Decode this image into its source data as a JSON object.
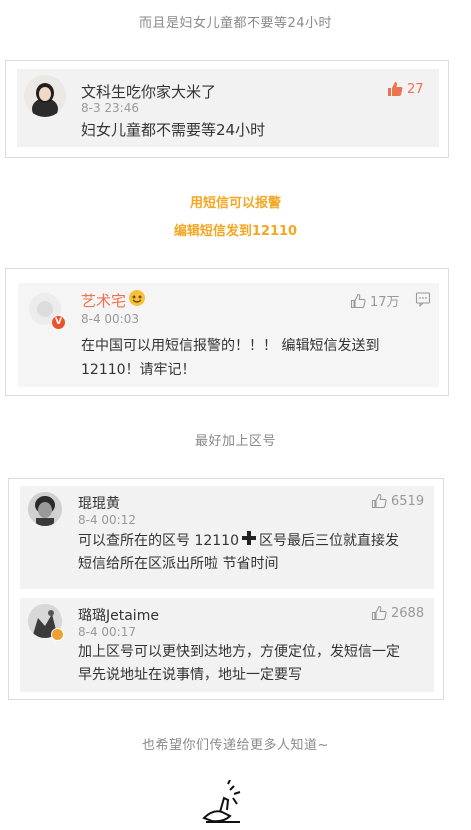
{
  "captions": {
    "top": "而且是妇女儿童都不要等24小时",
    "sms_line1": "用短信可以报警",
    "sms_line2": "编辑短信发到12110",
    "area_code": "最好加上区号",
    "bottom": "也希望你们传递给更多人知道~"
  },
  "comments": [
    {
      "user": "文科生吃你家大米了",
      "time": "8-3 23:46",
      "text": "妇女儿童都不需要等24小时",
      "likes": "27",
      "liked": true
    },
    {
      "user": "艺术宅",
      "time": "8-4 00:03",
      "text_line1": "在中国可以用短信报警的！！！ 编辑短信发送到",
      "text_line2": "12110！请牢记！",
      "likes": "17万",
      "liked": false,
      "badge": "V"
    },
    {
      "user": "琨琨黄",
      "time": "8-4 00:12",
      "text_line1a": "可以查所在的区号  12110",
      "text_line1b": "区号最后三位就直接发",
      "text_line2": "短信给所在区派出所啦  节省时间",
      "likes": "6519",
      "liked": false
    },
    {
      "user": "璐璐Jetaime",
      "time": "8-4 00:17",
      "text_line1": "加上区号可以更快到达地方，方便定位，发短信一定",
      "text_line2": "早先说地址在说事情，地址一定要写",
      "likes": "2688",
      "liked": false
    }
  ],
  "colors": {
    "accent_orange": "#f5a623",
    "liked_orange": "#eb7350",
    "bubble_gray": "#f2f2f2"
  }
}
